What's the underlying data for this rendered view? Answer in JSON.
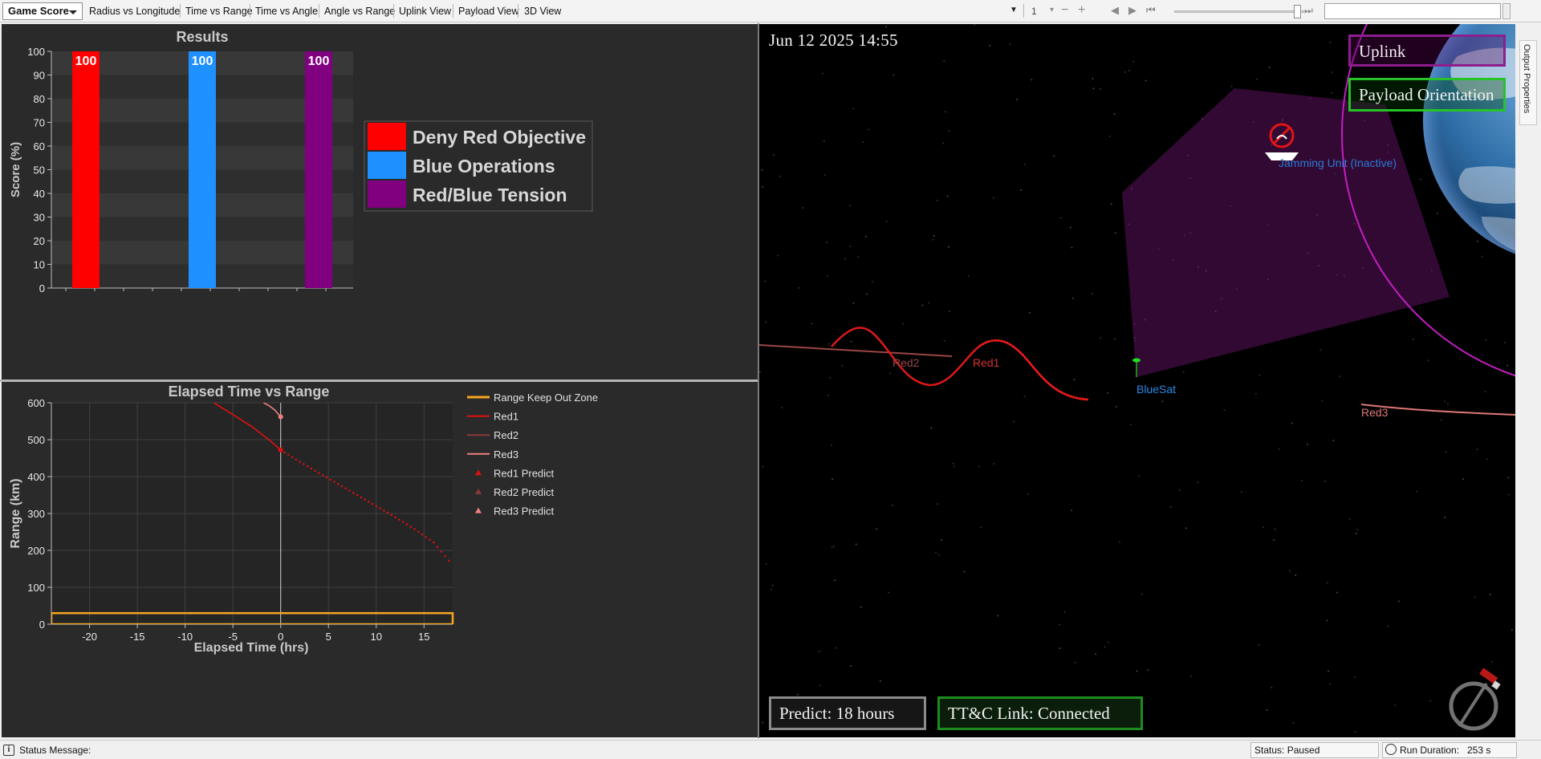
{
  "toolbar": {
    "selected_tab": "Game Score",
    "tabs": [
      "Radius vs Longitude",
      "Time vs Range",
      "Time vs Angle",
      "Angle vs Range",
      "Uplink View",
      "Payload View",
      "3D View"
    ],
    "speed_value": "1"
  },
  "side_tab": "Output Properties",
  "results_chart": {
    "chart_data": {
      "type": "bar",
      "title": "Results",
      "ylabel": "Score (%)",
      "xlabel": "",
      "ylim": [
        0,
        100
      ],
      "yticks": [
        0,
        10,
        20,
        30,
        40,
        50,
        60,
        70,
        80,
        90,
        100
      ],
      "categories": [
        "Deny Red Objective",
        "Blue Operations",
        "Red/Blue Tension"
      ],
      "values": [
        100,
        100,
        100
      ],
      "colors": [
        "#ff0000",
        "#1e90ff",
        "#800080"
      ],
      "legend_position": "right"
    }
  },
  "range_chart": {
    "chart_data": {
      "type": "line",
      "title": "Elapsed Time vs Range",
      "xlabel": "Elapsed Time (hrs)",
      "ylabel": "Range (km)",
      "xlim": [
        -24,
        18
      ],
      "ylim": [
        0,
        600
      ],
      "xticks": [
        -20,
        -15,
        -10,
        -5,
        0,
        5,
        10,
        15
      ],
      "yticks": [
        0,
        100,
        200,
        300,
        400,
        500,
        600
      ],
      "grid": true,
      "legend_position": "right",
      "current_time": 0,
      "series": [
        {
          "name": "Range Keep Out Zone",
          "color": "#f5a623",
          "style": "zone",
          "x": [
            -24,
            18
          ],
          "y_low": 0,
          "y_high": 30
        },
        {
          "name": "Red1",
          "color": "#e01010",
          "x": [
            -7,
            -5,
            -3,
            -1,
            0
          ],
          "y": [
            600,
            568,
            535,
            495,
            472
          ]
        },
        {
          "name": "Red2",
          "color": "#8a3a3a",
          "x": [],
          "y": []
        },
        {
          "name": "Red3",
          "color": "#f08080",
          "x": [
            -1.8,
            -1.2,
            -0.6,
            0
          ],
          "y": [
            600,
            592,
            580,
            562
          ]
        },
        {
          "name": "Red1 Predict",
          "color": "#e01010",
          "marker": "triangle",
          "x": [
            0,
            2,
            4,
            6,
            8,
            10,
            12,
            14,
            16,
            18
          ],
          "y": [
            472,
            440,
            410,
            380,
            350,
            320,
            290,
            258,
            222,
            160
          ]
        },
        {
          "name": "Red2 Predict",
          "color": "#8a3a3a",
          "marker": "triangle",
          "x": [],
          "y": []
        },
        {
          "name": "Red3 Predict",
          "color": "#f08080",
          "marker": "triangle",
          "x": [],
          "y": []
        }
      ]
    }
  },
  "view3d": {
    "datetime": "Jun 12 2025  14:55",
    "uplink_button": "Uplink",
    "payload_button": "Payload Orientation",
    "predict_label": "Predict: 18 hours",
    "ttc_label": "TT&C Link: Connected",
    "labels": {
      "red1": "Red1",
      "red2": "Red2",
      "red3": "Red3",
      "bluesat": "BlueSat",
      "jamming": "Jamming Unit (Inactive)"
    }
  },
  "statusbar": {
    "message_label": "Status Message:",
    "status": "Status: Paused",
    "run_duration_label": "Run Duration:",
    "run_duration_value": "253 s"
  }
}
